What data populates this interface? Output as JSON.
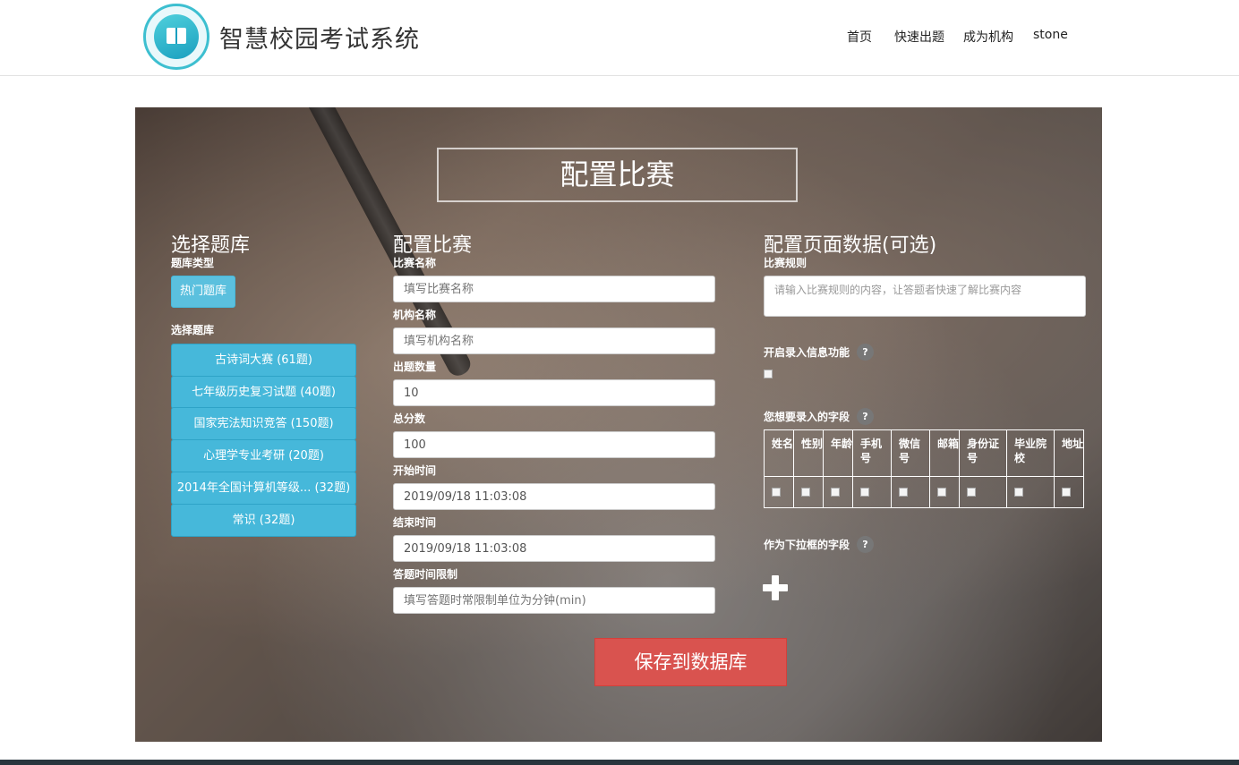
{
  "header": {
    "brand": "智慧校园考试系统",
    "nav": [
      "首页",
      "快速出题",
      "成为机构",
      "stone"
    ]
  },
  "main": {
    "title": "配置比赛",
    "left": {
      "heading": "选择题库",
      "type_label": "题库类型",
      "hot_button": "热门题库",
      "select_label": "选择题库",
      "banks": [
        "古诗词大赛 (61题)",
        "七年级历史复习试题 (40题)",
        "国家宪法知识竞答 (150题)",
        "心理学专业考研 (20题)",
        "2014年全国计算机等级... (32题)",
        "常识 (32题)"
      ]
    },
    "middle": {
      "heading": "配置比赛",
      "fields": [
        {
          "label": "比赛名称",
          "value": "",
          "placeholder": "填写比赛名称"
        },
        {
          "label": "机构名称",
          "value": "",
          "placeholder": "填写机构名称"
        },
        {
          "label": "出题数量",
          "value": "10",
          "placeholder": ""
        },
        {
          "label": "总分数",
          "value": "100",
          "placeholder": ""
        },
        {
          "label": "开始时间",
          "value": "2019/09/18 11:03:08",
          "placeholder": ""
        },
        {
          "label": "结束时间",
          "value": "2019/09/18 11:03:08",
          "placeholder": ""
        },
        {
          "label": "答题时间限制",
          "value": "",
          "placeholder": "填写答题时常限制单位为分钟(min)"
        }
      ]
    },
    "right": {
      "heading": "配置页面数据(可选)",
      "rules_label": "比赛规则",
      "rules_placeholder": "请输入比赛规则的内容，让答题者快速了解比赛内容",
      "enable_label": "开启录入信息功能",
      "fields_label": "您想要录入的字段",
      "dropdown_label": "作为下拉框的字段",
      "help": "?",
      "field_columns": [
        "姓名",
        "性别",
        "年龄",
        "手机号",
        "微信号",
        "邮箱",
        "身份证号",
        "毕业院校",
        "地址"
      ]
    },
    "save_button": "保存到数据库"
  },
  "colors": {
    "accent": "#5bc0de",
    "danger": "#d9534f",
    "footer": "#28353d"
  }
}
